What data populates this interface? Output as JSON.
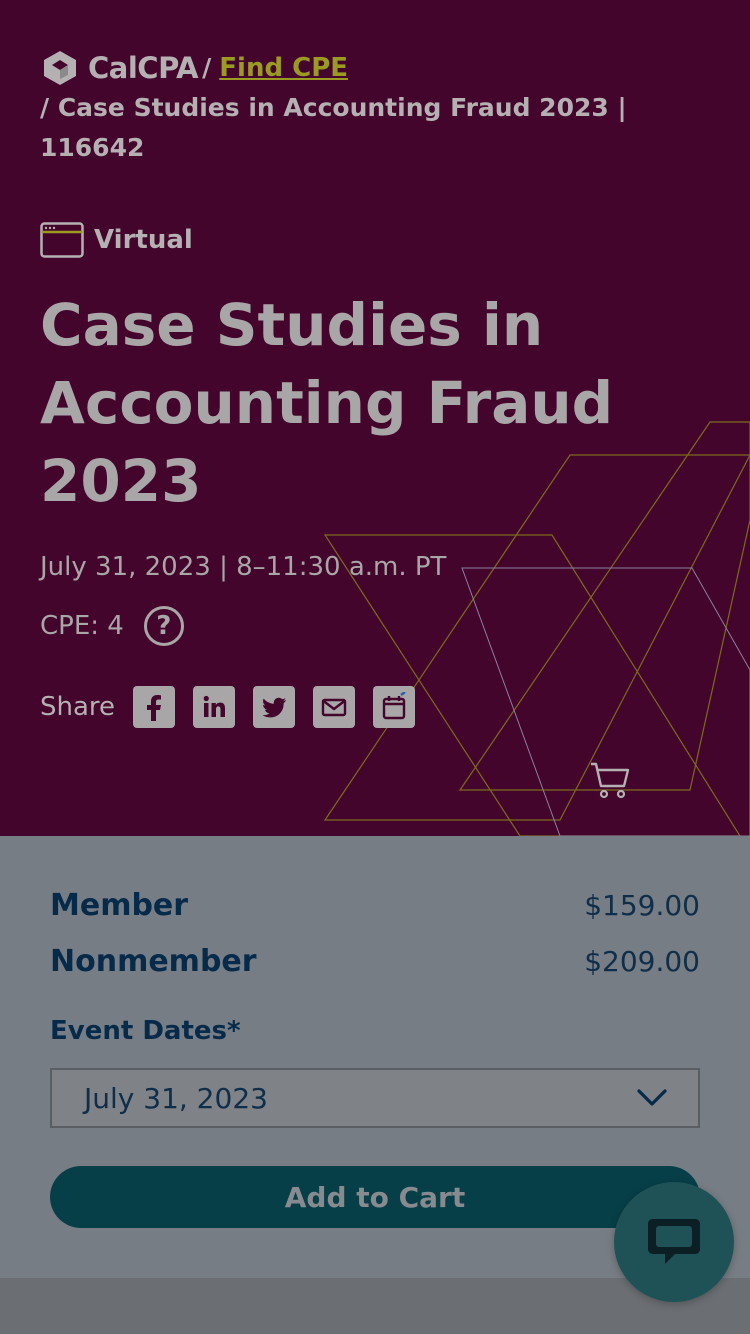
{
  "breadcrumb": {
    "logo_text": "CalCPA",
    "sep1": "/",
    "link_label": "Find CPE",
    "rest": "/ Case Studies in Accounting Fraud 2023 | 116642"
  },
  "event": {
    "format_label": "Virtual",
    "title": "Case Studies in Accounting Fraud 2023",
    "date_time": "July 31, 2023 | 8–11:30 a.m. PT",
    "cpe_label": "CPE: 4",
    "help_glyph": "?",
    "share_label": "Share",
    "share_icons": [
      "facebook-icon",
      "linkedin-icon",
      "twitter-icon",
      "email-icon",
      "calendar-icon"
    ]
  },
  "pricing": {
    "member_label": "Member",
    "member_price": "$159.00",
    "nonmember_label": "Nonmember",
    "nonmember_price": "$209.00"
  },
  "registration": {
    "dates_label": "Event Dates*",
    "selected_date": "July 31, 2023",
    "add_to_cart_label": "Add to Cart"
  },
  "colors": {
    "hero_bg": "#43052b",
    "link": "#9b9a21",
    "button": "#073f48",
    "chat": "#1e5257"
  }
}
